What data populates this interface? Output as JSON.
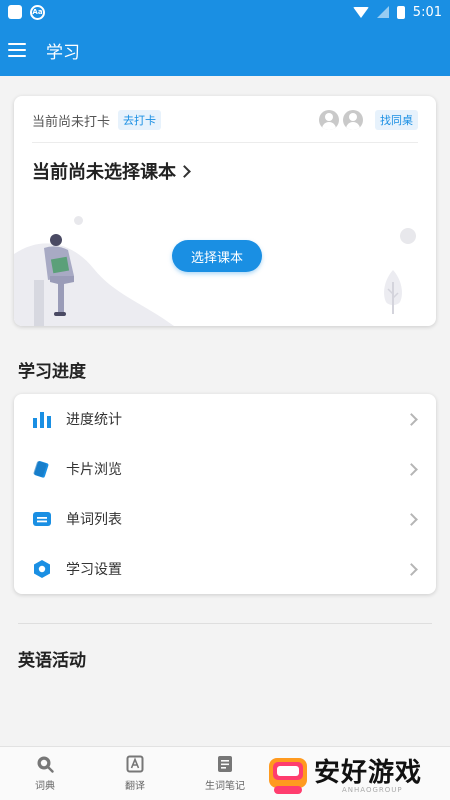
{
  "status_bar": {
    "time": "5:01",
    "search_badge": "Aa"
  },
  "app_bar": {
    "title": "学习"
  },
  "checkin": {
    "status_text": "当前尚未打卡",
    "checkin_label": "去打卡",
    "find_partner_label": "找同桌"
  },
  "textbook": {
    "title": "当前尚未选择课本",
    "select_button": "选择课本"
  },
  "progress": {
    "section_title": "学习进度",
    "items": [
      {
        "label": "进度统计",
        "icon": "bar-chart-icon"
      },
      {
        "label": "卡片浏览",
        "icon": "cards-icon"
      },
      {
        "label": "单词列表",
        "icon": "word-list-icon"
      },
      {
        "label": "学习设置",
        "icon": "settings-icon"
      }
    ]
  },
  "activities": {
    "section_title": "英语活动"
  },
  "bottom_nav": [
    {
      "label": "词典",
      "icon": "dictionary-icon"
    },
    {
      "label": "翻译",
      "icon": "translate-icon"
    },
    {
      "label": "生词笔记",
      "icon": "notes-icon"
    }
  ],
  "watermark": {
    "text": "安好游戏",
    "subtext": "ANHAOGROUP"
  },
  "colors": {
    "primary": "#1a8fe3",
    "background": "#f3f3f3",
    "card": "#ffffff"
  }
}
